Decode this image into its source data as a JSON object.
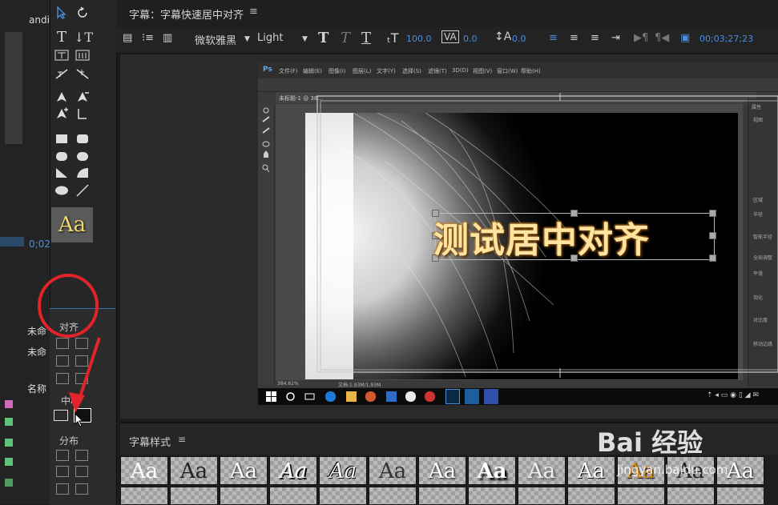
{
  "left_panel": {
    "top_text": "andi",
    "timecode": "0;02",
    "items": [
      "未命",
      "未命",
      "名称"
    ]
  },
  "tools": {
    "style_swatch_label": "Aa",
    "align_section_label": "对齐",
    "center_section_label": "中心",
    "distribute_section_label": "分布"
  },
  "title_bar": {
    "title": "字幕：字幕快速居中对齐",
    "menu_glyph": "≡"
  },
  "toolbar": {
    "font_family": "微软雅黑",
    "font_style": "Light",
    "font_size": "100.0",
    "kerning": "0.0",
    "leading": "0.0",
    "timecode": "00;03;27;23"
  },
  "photoshop": {
    "logo": "Ps",
    "menu_items": [
      "文件(F)",
      "编辑(E)",
      "图像(I)",
      "图层(L)",
      "文字(Y)",
      "选择(S)",
      "滤镜(T)",
      "3D(D)",
      "视图(V)",
      "窗口(W)",
      "帮助(H)"
    ],
    "tab_label": "未标题-1 @ 38...",
    "zoom_status": "384.61%",
    "doc_status": "文档:1.93M/1.93M",
    "right_panel_labels": [
      "属性",
      "视图",
      "区域",
      "半径",
      "智能半径",
      "全局调整",
      "平滑",
      "羽化",
      "对比度",
      "移动边缘"
    ],
    "subtitle_text": "测试居中对齐"
  },
  "styles_panel": {
    "title": "字幕样式",
    "menu_glyph": "≡",
    "tiles": [
      "Aa",
      "Aa",
      "Aa",
      "Aa",
      "Aa",
      "Aa",
      "Aa",
      "Aa",
      "Aa",
      "Aa",
      "Aa",
      "Aa",
      "Aa"
    ]
  },
  "watermark": {
    "text": "Bai 经验",
    "sub": "jingyan.baidu.com"
  },
  "colors": {
    "accent_blue": "#4a8ee0",
    "annotation_red": "#e0242a",
    "subtitle_gold": "#ffe3a0"
  }
}
